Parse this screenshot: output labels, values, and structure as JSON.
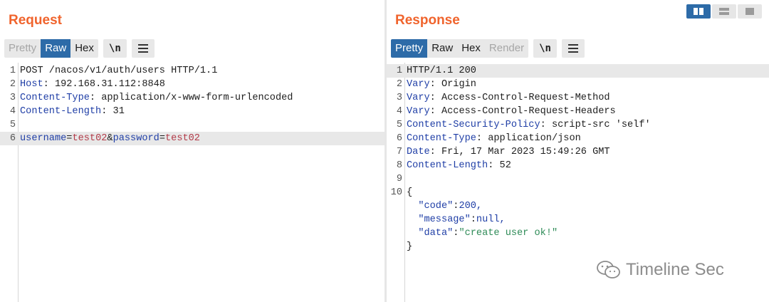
{
  "request": {
    "title": "Request",
    "tabs": [
      {
        "label": "Pretty",
        "state": "inactive"
      },
      {
        "label": "Raw",
        "state": "active"
      },
      {
        "label": "Hex",
        "state": "normal"
      }
    ],
    "newline_button": "\\n",
    "menu_icon": "hamburger-menu-icon",
    "lines": [
      {
        "n": "1",
        "text": "POST /nacos/v1/auth/users HTTP/1.1"
      },
      {
        "n": "2",
        "key": "Host",
        "value": " 192.168.31.112:8848"
      },
      {
        "n": "3",
        "key": "Content-Type",
        "value": " application/x-www-form-urlencoded"
      },
      {
        "n": "4",
        "key": "Content-Length",
        "value": " 31"
      },
      {
        "n": "5",
        "text": ""
      },
      {
        "n": "6",
        "body": {
          "k1": "username",
          "v1": "test02",
          "amp": "&",
          "k2": "password",
          "v2": "test02",
          "eq": "="
        }
      }
    ]
  },
  "response": {
    "title": "Response",
    "tabs": [
      {
        "label": "Pretty",
        "state": "active"
      },
      {
        "label": "Raw",
        "state": "normal"
      },
      {
        "label": "Hex",
        "state": "normal"
      },
      {
        "label": "Render",
        "state": "disabled"
      }
    ],
    "newline_button": "\\n",
    "menu_icon": "hamburger-menu-icon",
    "lines": [
      {
        "n": "1",
        "text": "HTTP/1.1 200"
      },
      {
        "n": "2",
        "key": "Vary",
        "value": " Origin"
      },
      {
        "n": "3",
        "key": "Vary",
        "value": " Access-Control-Request-Method"
      },
      {
        "n": "4",
        "key": "Vary",
        "value": " Access-Control-Request-Headers"
      },
      {
        "n": "5",
        "key": "Content-Security-Policy",
        "value": " script-src 'self'"
      },
      {
        "n": "6",
        "key": "Content-Type",
        "value": " application/json"
      },
      {
        "n": "7",
        "key": "Date",
        "value": " Fri, 17 Mar 2023 15:49:26 GMT"
      },
      {
        "n": "8",
        "key": "Content-Length",
        "value": " 52"
      },
      {
        "n": "9",
        "text": ""
      },
      {
        "n": "10",
        "text": "{"
      },
      {
        "n": "",
        "json_key": "\"code\"",
        "json_val": "200,",
        "val_type": "number"
      },
      {
        "n": "",
        "json_key": "\"message\"",
        "json_val": "null,",
        "val_type": "number"
      },
      {
        "n": "",
        "json_key": "\"data\"",
        "json_val": "\"create user ok!\"",
        "val_type": "string"
      },
      {
        "n": "",
        "text": "}"
      }
    ]
  },
  "layout_switch": [
    "side-by-side-icon",
    "stacked-horizontal-icon",
    "single-pane-icon"
  ],
  "watermark": {
    "icon": "wechat-icon",
    "text": "Timeline Sec"
  },
  "colors": {
    "title": "#f0642d",
    "active_tab": "#2d6ba8",
    "header_key": "#1f3ea6",
    "param_value": "#b23a48",
    "json_string": "#2e8b57"
  }
}
